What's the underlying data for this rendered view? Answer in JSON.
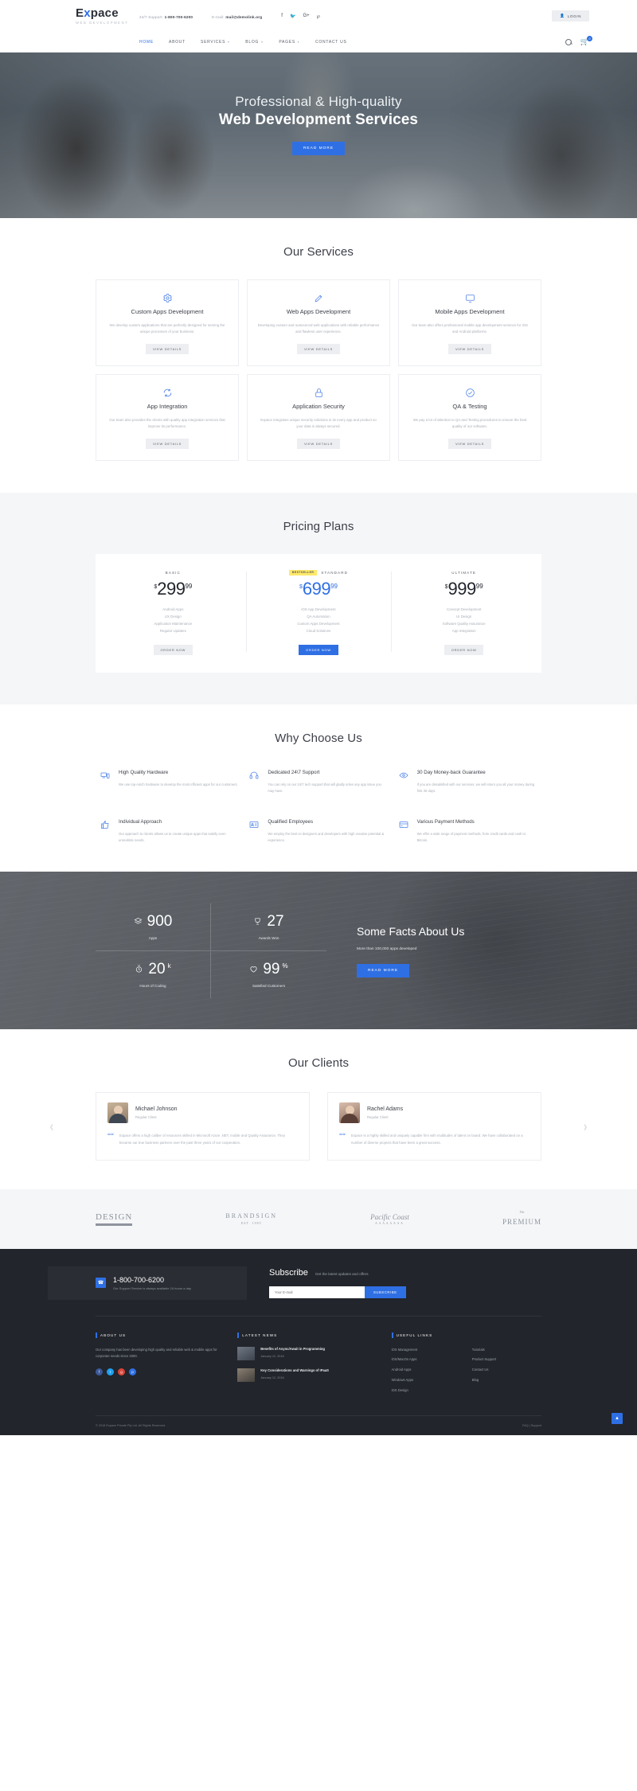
{
  "header": {
    "logo_main": "Expace",
    "logo_x": "x",
    "logo_sub": "WEB DEVELOPMENT",
    "support_label": "24/7 Support:",
    "support_phone": "1-800-700-6200",
    "email_label": "E-mail:",
    "email_value": "mail@demolink.org",
    "login_label": "LOGIN",
    "cart_count": "0",
    "socials": [
      "facebook-icon",
      "twitter-icon",
      "google-plus-icon",
      "pinterest-icon"
    ],
    "nav": [
      {
        "label": "HOME",
        "active": true,
        "caret": false
      },
      {
        "label": "ABOUT",
        "active": false,
        "caret": false
      },
      {
        "label": "SERVICES",
        "active": false,
        "caret": true
      },
      {
        "label": "BLOG",
        "active": false,
        "caret": true
      },
      {
        "label": "PAGES",
        "active": false,
        "caret": true
      },
      {
        "label": "CONTACT US",
        "active": false,
        "caret": false
      }
    ]
  },
  "hero": {
    "line1": "Professional & High-quality",
    "line2": "Web Development Services",
    "cta": "READ MORE"
  },
  "services": {
    "title": "Our Services",
    "button_label": "VIEW DETAILS",
    "items": [
      {
        "icon": "gear-icon",
        "title": "Custom Apps Development",
        "text": "We develop custom applications that are perfectly designed for serving the unique processes of your business."
      },
      {
        "icon": "pencil-icon",
        "title": "Web Apps Development",
        "text": "Developing custom and outsourced web applications with reliable performance and flawless user experience."
      },
      {
        "icon": "monitor-icon",
        "title": "Mobile Apps Development",
        "text": "Our team also offers professional mobile app development services for iOS and Android platforms."
      },
      {
        "icon": "refresh-icon",
        "title": "App Integration",
        "text": "Our team also provides the clients with quality app integration services that improve its performance."
      },
      {
        "icon": "lock-icon",
        "title": "Application Security",
        "text": "Expace integrates unique security solutions in its every app and product so your data is always secured."
      },
      {
        "icon": "checkmark-circle-icon",
        "title": "QA & Testing",
        "text": "We pay a lot of attention to QA and Testing procedures to ensure the best quality of our software."
      }
    ]
  },
  "pricing": {
    "title": "Pricing Plans",
    "plans": [
      {
        "name": "BASIC",
        "badge": "",
        "currency": "$",
        "amount": "299",
        "cents": "99",
        "featured": false,
        "features": [
          "Android Apps",
          "UX Design",
          "Application Maintenance",
          "Regular Updates"
        ],
        "cta": "ORDER NOW"
      },
      {
        "name": "STANDARD",
        "badge": "BESTSELLER",
        "currency": "$",
        "amount": "699",
        "cents": "99",
        "featured": true,
        "features": [
          "iOS App Development",
          "QA Automation",
          "Custom Apps Development",
          "Cloud Solutions"
        ],
        "cta": "ORDER NOW"
      },
      {
        "name": "ULTIMATE",
        "badge": "",
        "currency": "$",
        "amount": "999",
        "cents": "99",
        "featured": false,
        "features": [
          "Concept Development",
          "UI Design",
          "Software Quality Assurance",
          "App Integration"
        ],
        "cta": "ORDER NOW"
      }
    ]
  },
  "why": {
    "title": "Why Choose Us",
    "items": [
      {
        "icon": "devices-icon",
        "title": "High Quality Hardware",
        "text": "We use top-notch hardware to develop the most efficient apps for our customers."
      },
      {
        "icon": "headset-icon",
        "title": "Dedicated 24\\7 Support",
        "text": "You can rely on our 24/7 tech support that will gladly solve any app issue you may have."
      },
      {
        "icon": "eye-icon",
        "title": "30 Day Money-back Guarantee",
        "text": "If you are dissatisfied with our services, we will return you all your money during first 30 days."
      },
      {
        "icon": "thumbs-up-icon",
        "title": "Individual Approach",
        "text": "Our approach to clients allows us to create unique apps that satisfy even unrealistic needs."
      },
      {
        "icon": "id-card-icon",
        "title": "Qualified Employees",
        "text": "We employ the best UI designers and developers with high creative potential & experience."
      },
      {
        "icon": "credit-card-icon",
        "title": "Various Payment Methods",
        "text": "We offer a wide range of payment methods, from credit cards and cash to Bitcoin."
      }
    ]
  },
  "facts": {
    "title": "Some Facts About Us",
    "subtitle": "More than 100,000 apps developed",
    "cta": "READ MORE",
    "counters": [
      {
        "icon": "layers-icon",
        "value": "900",
        "suffix": "",
        "label": "Apps"
      },
      {
        "icon": "trophy-icon",
        "value": "27",
        "suffix": "",
        "label": "Awards Won"
      },
      {
        "icon": "clock-icon",
        "value": "20",
        "suffix": "k",
        "label": "Hours of Coding"
      },
      {
        "icon": "heart-icon",
        "value": "99",
        "suffix": "%",
        "label": "Satisfied Customers"
      }
    ]
  },
  "clients": {
    "title": "Our Clients",
    "testimonials": [
      {
        "name": "Michael Johnson",
        "role": "Regular Client",
        "text": "Expace offers a high caliber of resources skilled in Microsoft Azure .NET, mobile and Quality Assurance. They became our true business partners over the past three years of our cooperation."
      },
      {
        "name": "Rachel Adams",
        "role": "Regular Client",
        "text": "Expace is a highly skilled and uniquely capable firm with multitudes of talent on board. We have collaborated on a number of diverse projects that have been a great success."
      }
    ]
  },
  "brands": [
    {
      "name": "DESIGN",
      "sub": ""
    },
    {
      "name": "BRANDSIGN",
      "sub": "EST. 1985"
    },
    {
      "name": "Pacific Coast",
      "sub": "AAAAAAAA"
    },
    {
      "name": "PREMIUM",
      "sub": "The"
    }
  ],
  "footer": {
    "phone": "1-800-700-6200",
    "phone_sub": "Our Support Service is always available 24 hours a day",
    "subscribe_title": "Subscribe",
    "subscribe_sub": "Get the latest updates and offers",
    "email_placeholder": "Your E-mail",
    "subscribe_btn": "SUBSCRIBE",
    "about": {
      "heading": "ABOUT US",
      "text": "Our company has been developing high quality and reliable web & mobile apps for corporate needs since 2000.",
      "socials": [
        "facebook-icon",
        "twitter-icon",
        "google-plus-icon",
        "pinterest-icon"
      ]
    },
    "news": {
      "heading": "LATEST NEWS",
      "items": [
        {
          "title": "Benefits of Async/Await in Programming",
          "date": "January 12, 2018"
        },
        {
          "title": "Key Considerations and Warnings of IPaaS",
          "date": "January 12, 2018"
        }
      ]
    },
    "links": {
      "heading": "USEFUL LINKS",
      "items": [
        "iOS Management",
        "iOS/MacOs Apps",
        "Android Apps",
        "Windows Apps",
        "iOS Design",
        "Tutorials",
        "Product Support",
        "Contact Us",
        "Blog"
      ]
    },
    "copyright": "© 2018 Expace Private Pty Ltd. All Rights Reserved.",
    "policy": "FAQ | Support",
    "to_top": "to-top-icon"
  }
}
